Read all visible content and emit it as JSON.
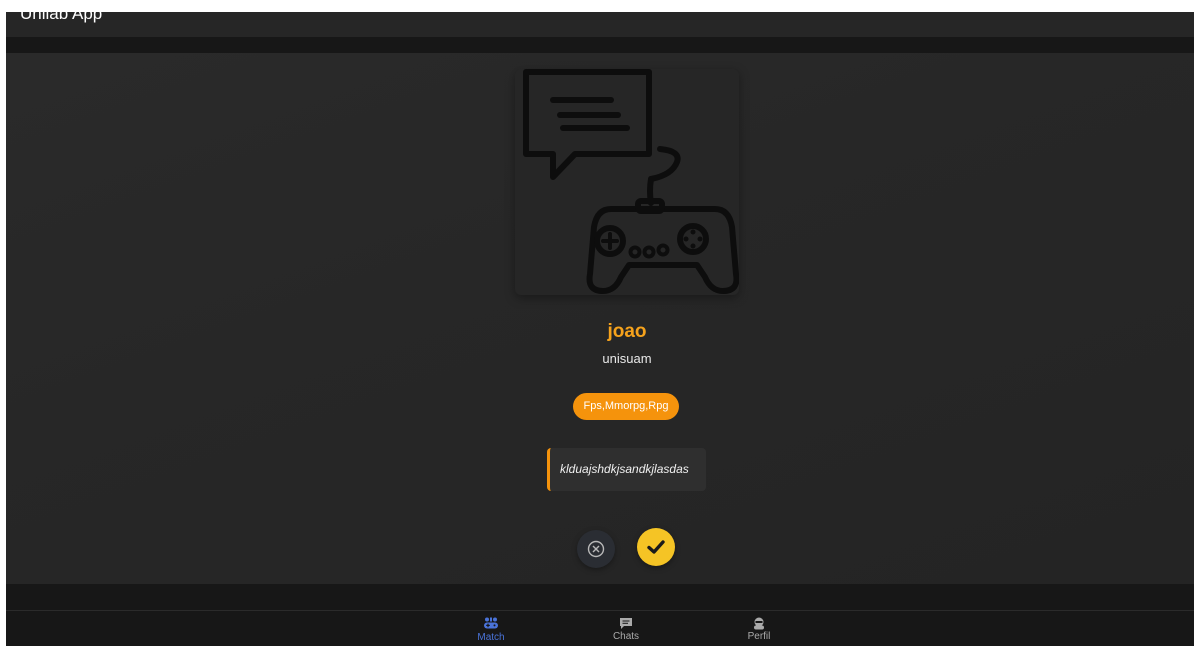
{
  "app": {
    "title": "Unilab App"
  },
  "profile": {
    "name": "joao",
    "school": "unisuam",
    "tags": "Fps,Mmorpg,Rpg",
    "bio": "klduajshdkjsandkjlasdas",
    "avatar_icon": "chat-gamepad-icon"
  },
  "actions": {
    "reject_icon": "close-circle-icon",
    "accept_icon": "checkmark-icon"
  },
  "nav": {
    "items": [
      {
        "label": "Match",
        "icon": "match-icon",
        "active": true
      },
      {
        "label": "Chats",
        "icon": "chat-icon",
        "active": false
      },
      {
        "label": "Perfil",
        "icon": "profile-icon",
        "active": false
      }
    ]
  },
  "colors": {
    "accent": "#f5930c",
    "name": "#f5a21c",
    "accept": "#f5c425",
    "nav_active": "#4a73d9",
    "background": "#232323"
  }
}
